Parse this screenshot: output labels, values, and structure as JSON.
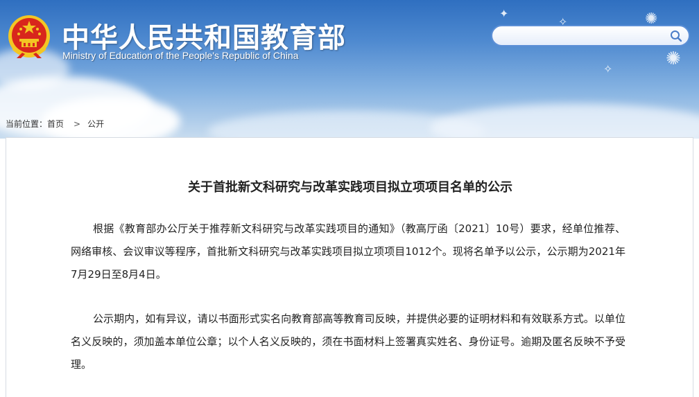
{
  "header": {
    "site_title": "中华人民共和国教育部",
    "site_subtitle": "Ministry of Education of the People's Republic of China",
    "emblem_icon": "national-emblem-icon"
  },
  "search": {
    "placeholder": "",
    "value": "",
    "icon": "search-icon"
  },
  "breadcrumb": {
    "label": "当前位置：",
    "items": [
      "首页",
      "公开"
    ],
    "separator": ">"
  },
  "article": {
    "title": "关于首批新文科研究与改革实践项目拟立项项目名单的公示",
    "paragraphs": [
      "根据《教育部办公厅关于推荐新文科研究与改革实践项目的通知》（教高厅函〔2021〕10号）要求，经单位推荐、网络审核、会议审议等程序，首批新文科研究与改革实践项目拟立项项目1012个。现将名单予以公示，公示期为2021年7月29日至8月4日。",
      "公示期内，如有异议，请以书面形式实名向教育部高等教育司反映，并提供必要的证明材料和有效联系方式。以单位名义反映的，须加盖本单位公章；以个人名义反映的，须在书面材料上签署真实姓名、身份证号。逾期及匿名反映不予受理。"
    ]
  },
  "colors": {
    "banner_top": "#2f6fc0",
    "banner_bottom": "#c8dcef",
    "emblem_red": "#d8261c",
    "emblem_gold": "#f3c623",
    "search_border": "#5c8fd6"
  }
}
